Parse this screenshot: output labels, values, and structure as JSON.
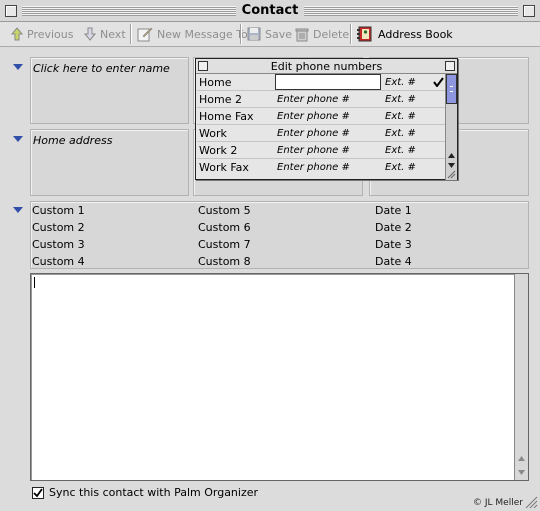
{
  "window": {
    "title": "Contact"
  },
  "toolbar": {
    "previous": "Previous",
    "next": "Next",
    "new_message": "New Message To",
    "save": "Save",
    "delete": "Delete",
    "address_book": "Address Book"
  },
  "name_panel": {
    "placeholder": "Click here to enter name"
  },
  "address_panel": {
    "placeholder": "Home address"
  },
  "phone_popup": {
    "title": "Edit phone numbers",
    "rows": [
      {
        "label": "Home",
        "phone": "",
        "ext": "Ext. #",
        "checked": true
      },
      {
        "label": "Home 2",
        "phone": "Enter phone #",
        "ext": "Ext. #"
      },
      {
        "label": "Home Fax",
        "phone": "Enter phone #",
        "ext": "Ext. #"
      },
      {
        "label": "Work",
        "phone": "Enter phone #",
        "ext": "Ext. #"
      },
      {
        "label": "Work 2",
        "phone": "Enter phone #",
        "ext": "Ext. #"
      },
      {
        "label": "Work Fax",
        "phone": "Enter phone #",
        "ext": "Ext. #"
      }
    ]
  },
  "custom_fields": {
    "col1": [
      "Custom 1",
      "Custom 2",
      "Custom 3",
      "Custom 4"
    ],
    "col2": [
      "Custom 5",
      "Custom 6",
      "Custom 7",
      "Custom 8"
    ],
    "col3": [
      "Date 1",
      "Date 2",
      "Date 3",
      "Date 4"
    ]
  },
  "notes": {
    "value": ""
  },
  "sync": {
    "label": "Sync this contact with Palm Organizer",
    "checked": true
  },
  "credit": "© JL Meller",
  "colors": {
    "triangle": "#2f4fa8",
    "background": "#dcdcdc"
  }
}
